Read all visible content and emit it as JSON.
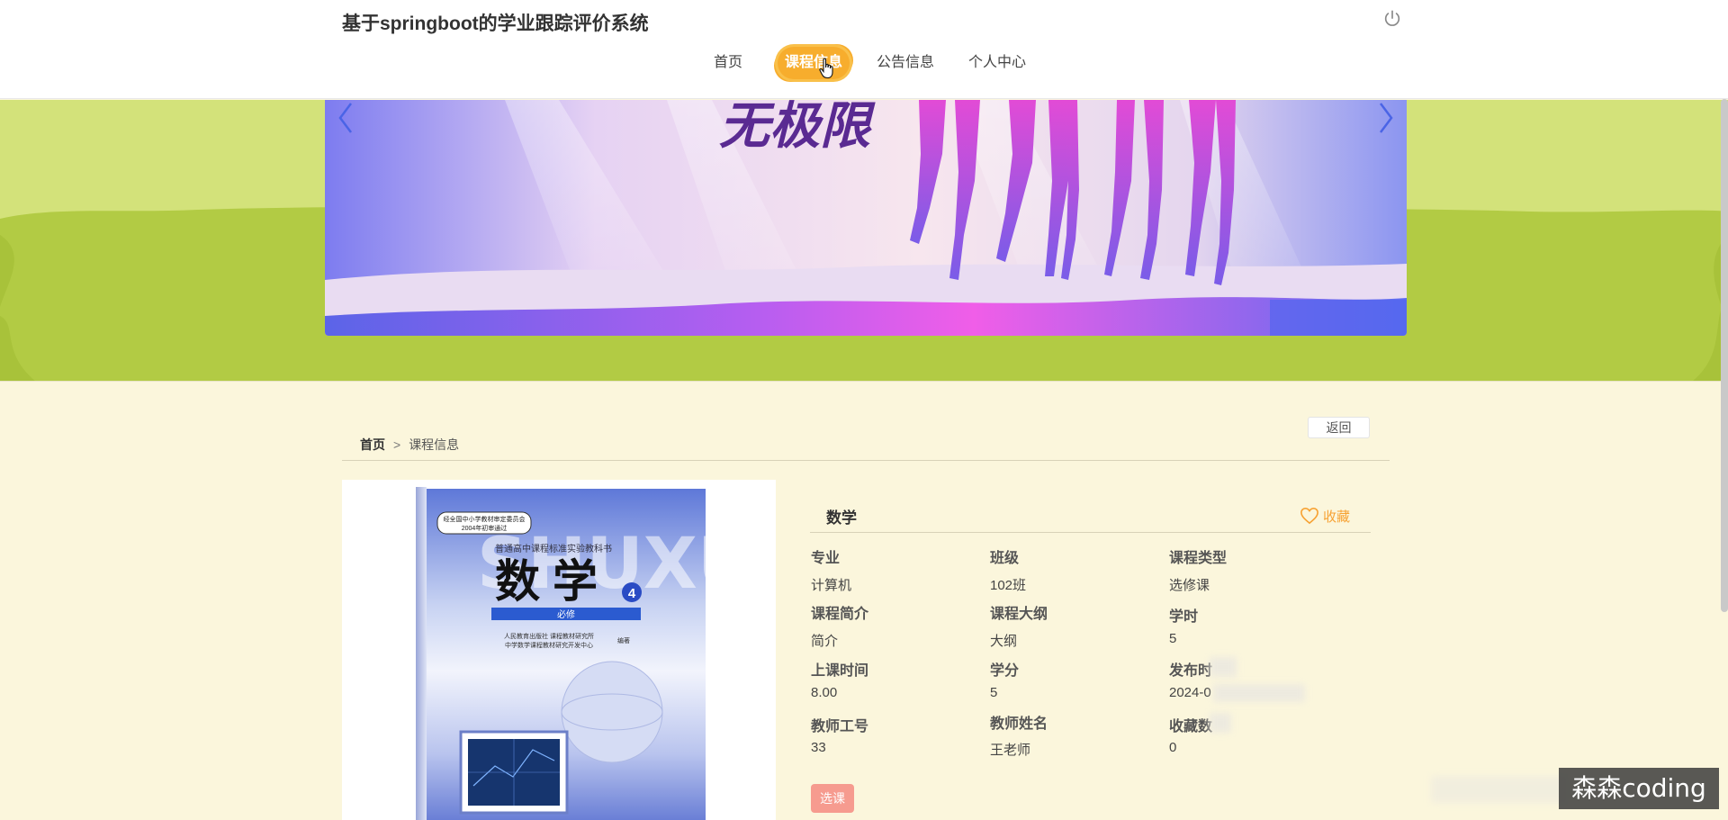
{
  "header": {
    "site_title": "基于springboot的学业跟踪评价系统",
    "nav": [
      {
        "label": "首页",
        "active": false
      },
      {
        "label": "课程信息",
        "active": true
      },
      {
        "label": "公告信息",
        "active": false
      },
      {
        "label": "个人中心",
        "active": false
      }
    ],
    "power_icon": "power-icon"
  },
  "banner": {
    "image_text": "无极限",
    "prev_icon": "chevron-left-icon",
    "next_icon": "chevron-right-icon"
  },
  "breadcrumb": {
    "home": "首页",
    "separator": ">",
    "current": "课程信息"
  },
  "back_label": "返回",
  "course": {
    "title": "数学",
    "favorite_label": "收藏",
    "fields": [
      {
        "label": "专业",
        "value": "计算机"
      },
      {
        "label": "班级",
        "value": "102班"
      },
      {
        "label": "课程类型",
        "value": "选修课"
      },
      {
        "label": "课程简介",
        "value": "简介"
      },
      {
        "label": "课程大纲",
        "value": "大纲"
      },
      {
        "label": "学时",
        "value": "5"
      },
      {
        "label": "上课时间",
        "value": "8.00"
      },
      {
        "label": "学分",
        "value": "5"
      },
      {
        "label": "发布时",
        "value": "2024-0"
      },
      {
        "label": "教师工号",
        "value": "33"
      },
      {
        "label": "教师姓名",
        "value": "王老师"
      },
      {
        "label": "收藏数",
        "value": "0"
      }
    ],
    "select_label": "选课"
  },
  "cover": {
    "badge_line1": "经全国中小学教材审定委员会",
    "badge_line2": "2004年初审通过",
    "series": "普通高中课程标准实验教科书",
    "title": "数学",
    "volume": "4",
    "subtitle": "必修",
    "publisher_line1": "人民教育出版社 课程教材研究所",
    "publisher_line2": "中学数学课程教材研究开发中心",
    "editor": "编著"
  },
  "watermark": "森森coding",
  "colors": {
    "accent": "#f7ad2d",
    "favorite": "#f7a233",
    "select_button": "#f69b8f",
    "banner_bg": "#d3e27a",
    "page_bg": "#fbf6dc"
  }
}
